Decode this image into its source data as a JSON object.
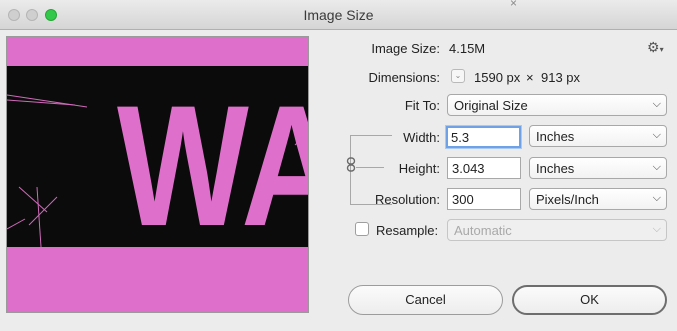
{
  "window": {
    "title": "Image Size",
    "background_tab_close": "×"
  },
  "info": {
    "image_size_label": "Image Size:",
    "image_size_value": "4.15M",
    "dimensions_label": "Dimensions:",
    "dimensions_width": "1590 px",
    "dimensions_separator": "×",
    "dimensions_height": "913 px"
  },
  "fit_to": {
    "label": "Fit To:",
    "value": "Original Size"
  },
  "width": {
    "label": "Width:",
    "value": "5.3",
    "unit": "Inches"
  },
  "height": {
    "label": "Height:",
    "value": "3.043",
    "unit": "Inches"
  },
  "resolution": {
    "label": "Resolution:",
    "value": "300",
    "unit": "Pixels/Inch"
  },
  "resample": {
    "label": "Resample:",
    "checked": false,
    "value": "Automatic"
  },
  "buttons": {
    "cancel": "Cancel",
    "ok": "OK"
  },
  "preview_image": {
    "visible_text": "WA"
  },
  "icons": {
    "settings": "gear-icon",
    "chain": "chain-link-icon",
    "dimensions_menu": "chevron-down-icon"
  },
  "colors": {
    "pink": "#de6fcb",
    "black": "#0b0b0b",
    "focus": "#6ea1e6",
    "traffic_green": "#34c84a"
  }
}
